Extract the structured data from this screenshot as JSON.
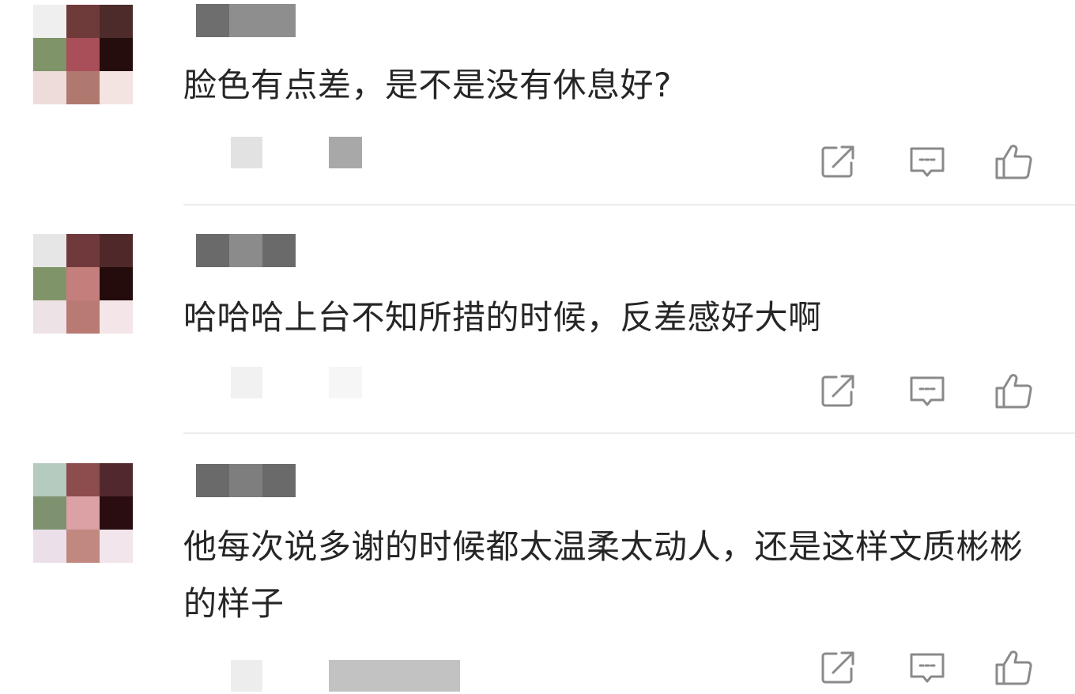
{
  "comments": [
    {
      "text": "脸色有点差，是不是没有休息好?",
      "avatar_colors": [
        "#efefef",
        "#6f3a3a",
        "#4d2b2b",
        "#7f9469",
        "#a94f59",
        "#250d0d",
        "#eddcda",
        "#b0796f",
        "#f3e4e2"
      ],
      "username_colors": [
        "#6e6e6e",
        "#8e8e8e",
        "#8e8e8e"
      ],
      "meta_colors": [
        "#e2e2e2",
        "#a8a8a8"
      ]
    },
    {
      "text": "哈哈哈上台不知所措的时候，反差感好大啊",
      "avatar_colors": [
        "#e6e6e6",
        "#703a3c",
        "#4f292a",
        "#809469",
        "#c47f7c",
        "#240b0c",
        "#ede2e6",
        "#b97a74",
        "#f4e6e8"
      ],
      "username_colors": [
        "#6a6a6a",
        "#8b8b8b",
        "#6a6a6a"
      ],
      "meta_colors": [
        "#f1f1f1",
        "#f6f6f6"
      ]
    },
    {
      "text": "他每次说多谢的时候都太温柔太动人，还是这样文质彬彬的样子",
      "avatar_colors": [
        "#b6cbbf",
        "#8d4c4d",
        "#51282d",
        "#7e9270",
        "#dba1a5",
        "#2a0d10",
        "#ebe0ea",
        "#c18880",
        "#f2e5ec"
      ],
      "username_colors": [
        "#6a6a6a",
        "#7e7e7e",
        "#6a6a6a"
      ],
      "meta_colors": [
        "#ededed",
        "#c2c2c2"
      ]
    }
  ],
  "actions": {
    "icon_color": "#8a8a8a",
    "share": "share-icon",
    "reply": "comment-icon",
    "like": "thumbs-up-icon"
  },
  "divider_color": "#ececec"
}
